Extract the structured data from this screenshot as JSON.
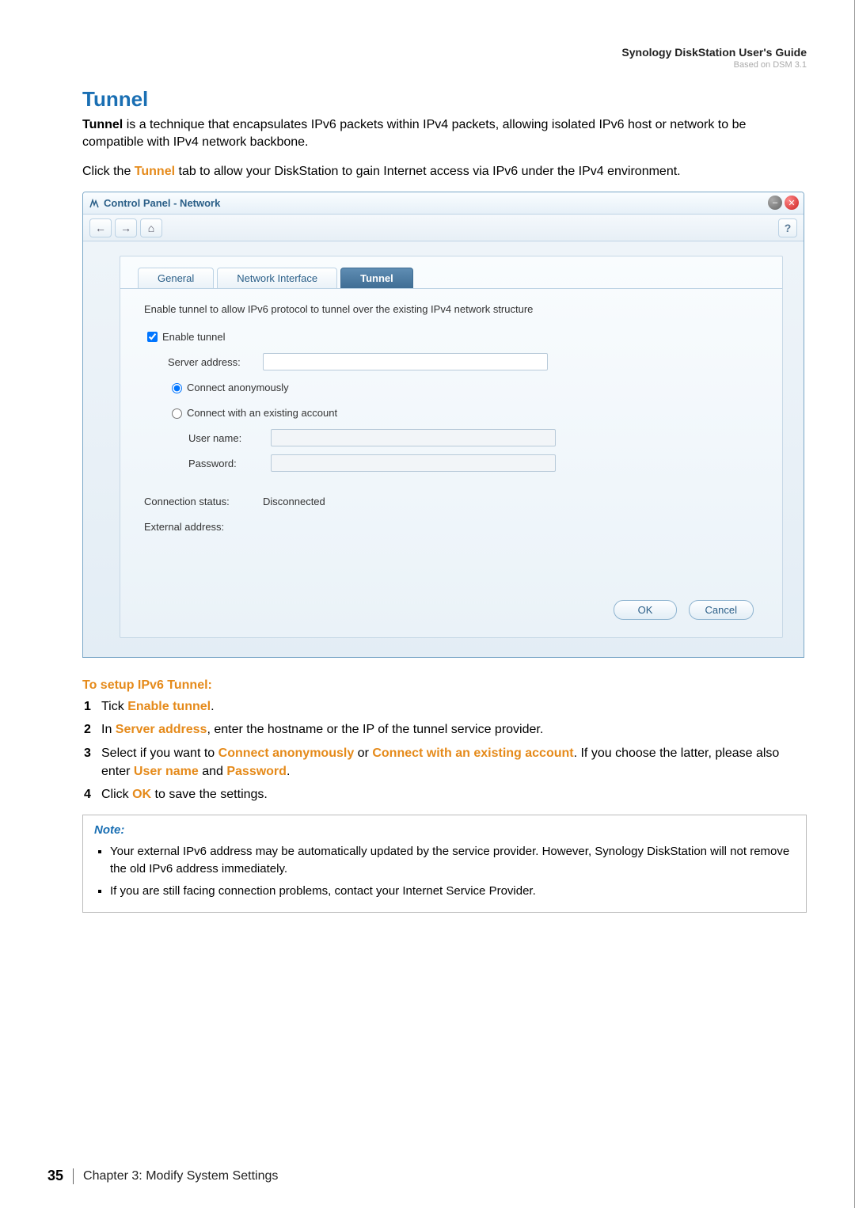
{
  "header": {
    "guide_title": "Synology DiskStation User's Guide",
    "based_on": "Based on DSM 3.1"
  },
  "section": {
    "title": "Tunnel",
    "intro_a_bold": "Tunnel",
    "intro_a_rest": " is a technique that encapsulates IPv6 packets within IPv4 packets, allowing isolated IPv6 host or network to be compatible with IPv4 network backbone.",
    "intro_b_pre": "Click the ",
    "intro_b_kw": "Tunnel",
    "intro_b_post": " tab to allow your DiskStation to gain Internet access via IPv6 under the IPv4 environment."
  },
  "window": {
    "title": "Control Panel - Network",
    "nav": {
      "back": "←",
      "fwd": "→",
      "home": "⌂",
      "help": "?"
    },
    "tabs": {
      "general": "General",
      "interface": "Network Interface",
      "tunnel": "Tunnel"
    },
    "form": {
      "description": "Enable tunnel to allow IPv6 protocol to tunnel over the existing IPv4 network structure",
      "enable_tunnel": "Enable tunnel",
      "server_address_label": "Server address:",
      "server_address_value": "",
      "connect_anon": "Connect anonymously",
      "connect_existing": "Connect with an existing account",
      "username_label": "User name:",
      "username_value": "",
      "password_label": "Password:",
      "password_value": "",
      "connection_status_label": "Connection status:",
      "connection_status_value": "Disconnected",
      "external_address_label": "External address:",
      "external_address_value": ""
    },
    "buttons": {
      "ok": "OK",
      "cancel": "Cancel"
    }
  },
  "setup": {
    "heading": "To setup IPv6 Tunnel:",
    "steps": {
      "s1_pre": "Tick ",
      "s1_kw": "Enable tunnel",
      "s1_post": ".",
      "s2_pre": "In ",
      "s2_kw": "Server address",
      "s2_post": ", enter the hostname or the IP of the tunnel service provider.",
      "s3_pre": "Select if you want to ",
      "s3_kw1": "Connect anonymously",
      "s3_mid1": " or ",
      "s3_kw2": "Connect with an existing account",
      "s3_mid2": ". If you choose the latter, please also enter ",
      "s3_kw3": "User name",
      "s3_mid3": " and ",
      "s3_kw4": "Password",
      "s3_post": ".",
      "s4_pre": "Click ",
      "s4_kw": "OK",
      "s4_post": " to save the settings."
    }
  },
  "note": {
    "title": "Note:",
    "item1": "Your external IPv6 address may be automatically updated by the service provider. However, Synology DiskStation will not remove the old IPv6 address immediately.",
    "item2": "If you are still facing connection problems, contact your Internet Service Provider."
  },
  "footer": {
    "page": "35",
    "chapter": "Chapter 3: Modify System Settings"
  }
}
